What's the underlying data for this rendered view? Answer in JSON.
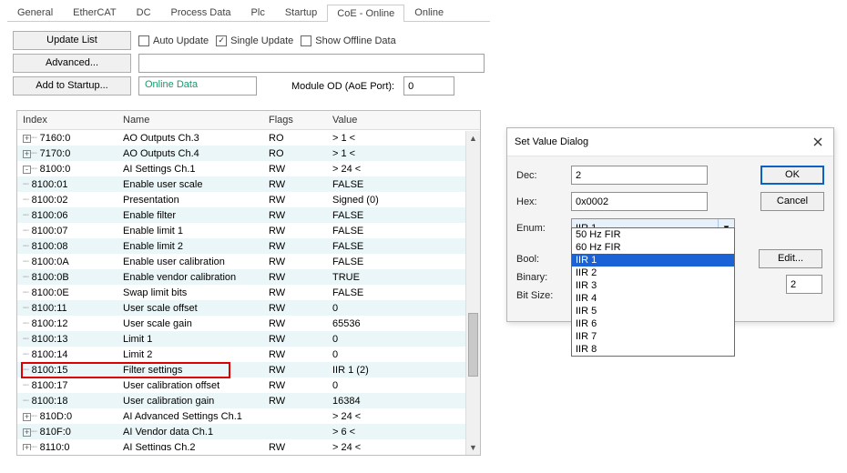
{
  "tabs": [
    "General",
    "EtherCAT",
    "DC",
    "Process Data",
    "Plc",
    "Startup",
    "CoE - Online",
    "Online"
  ],
  "activeTab": "CoE - Online",
  "buttons": {
    "update": "Update List",
    "advanced": "Advanced...",
    "addstartup": "Add to Startup..."
  },
  "checks": {
    "auto": "Auto Update",
    "single": "Single Update",
    "offline": "Show Offline Data"
  },
  "onlineBadge": "Online Data",
  "moduleOd": {
    "label": "Module OD (AoE Port):",
    "value": "0"
  },
  "columns": {
    "index": "Index",
    "name": "Name",
    "flags": "Flags",
    "value": "Value"
  },
  "rows": [
    {
      "pm": "+",
      "idx": "7160:0",
      "name": "AO Outputs Ch.3",
      "flags": "RO",
      "val": "> 1 <",
      "alt": false
    },
    {
      "pm": "+",
      "idx": "7170:0",
      "name": "AO Outputs Ch.4",
      "flags": "RO",
      "val": "> 1 <",
      "alt": true
    },
    {
      "pm": "-",
      "idx": "8100:0",
      "name": "AI Settings Ch.1",
      "flags": "RW",
      "val": "> 24 <",
      "alt": false
    },
    {
      "pm": "",
      "idx": "8100:01",
      "name": "Enable user scale",
      "flags": "RW",
      "val": "FALSE",
      "alt": true,
      "child": true
    },
    {
      "pm": "",
      "idx": "8100:02",
      "name": "Presentation",
      "flags": "RW",
      "val": "Signed (0)",
      "alt": false,
      "child": true
    },
    {
      "pm": "",
      "idx": "8100:06",
      "name": "Enable filter",
      "flags": "RW",
      "val": "FALSE",
      "alt": true,
      "child": true
    },
    {
      "pm": "",
      "idx": "8100:07",
      "name": "Enable limit 1",
      "flags": "RW",
      "val": "FALSE",
      "alt": false,
      "child": true
    },
    {
      "pm": "",
      "idx": "8100:08",
      "name": "Enable limit 2",
      "flags": "RW",
      "val": "FALSE",
      "alt": true,
      "child": true
    },
    {
      "pm": "",
      "idx": "8100:0A",
      "name": "Enable user calibration",
      "flags": "RW",
      "val": "FALSE",
      "alt": false,
      "child": true
    },
    {
      "pm": "",
      "idx": "8100:0B",
      "name": "Enable vendor calibration",
      "flags": "RW",
      "val": "TRUE",
      "alt": true,
      "child": true
    },
    {
      "pm": "",
      "idx": "8100:0E",
      "name": "Swap limit bits",
      "flags": "RW",
      "val": "FALSE",
      "alt": false,
      "child": true
    },
    {
      "pm": "",
      "idx": "8100:11",
      "name": "User scale offset",
      "flags": "RW",
      "val": "0",
      "alt": true,
      "child": true
    },
    {
      "pm": "",
      "idx": "8100:12",
      "name": "User scale gain",
      "flags": "RW",
      "val": "65536",
      "alt": false,
      "child": true
    },
    {
      "pm": "",
      "idx": "8100:13",
      "name": "Limit 1",
      "flags": "RW",
      "val": "0",
      "alt": true,
      "child": true
    },
    {
      "pm": "",
      "idx": "8100:14",
      "name": "Limit 2",
      "flags": "RW",
      "val": "0",
      "alt": false,
      "child": true
    },
    {
      "pm": "",
      "idx": "8100:15",
      "name": "Filter settings",
      "flags": "RW",
      "val": "IIR 1 (2)",
      "alt": true,
      "child": true,
      "boxed": true
    },
    {
      "pm": "",
      "idx": "8100:17",
      "name": "User calibration offset",
      "flags": "RW",
      "val": "0",
      "alt": false,
      "child": true
    },
    {
      "pm": "",
      "idx": "8100:18",
      "name": "User calibration gain",
      "flags": "RW",
      "val": "16384",
      "alt": true,
      "child": true
    },
    {
      "pm": "+",
      "idx": "810D:0",
      "name": "AI Advanced Settings Ch.1",
      "flags": "",
      "val": "> 24 <",
      "alt": false
    },
    {
      "pm": "+",
      "idx": "810F:0",
      "name": "AI Vendor data Ch.1",
      "flags": "",
      "val": "> 6 <",
      "alt": true
    },
    {
      "pm": "+",
      "idx": "8110:0",
      "name": "AI Settings Ch.2",
      "flags": "RW",
      "val": "> 24 <",
      "alt": false
    }
  ],
  "dialog": {
    "title": "Set Value Dialog",
    "dec": {
      "label": "Dec:",
      "value": "2"
    },
    "hex": {
      "label": "Hex:",
      "value": "0x0002"
    },
    "enum": {
      "label": "Enum:",
      "value": "IIR 1"
    },
    "bool": {
      "label": "Bool:"
    },
    "binary": {
      "label": "Binary:"
    },
    "bitsize": {
      "label": "Bit Size:"
    },
    "spin": "2",
    "ok": "OK",
    "cancel": "Cancel",
    "edit": "Edit...",
    "options": [
      "50 Hz FIR",
      "60 Hz FIR",
      "IIR 1",
      "IIR 2",
      "IIR 3",
      "IIR 4",
      "IIR 5",
      "IIR 6",
      "IIR 7",
      "IIR 8"
    ],
    "selected": "IIR 1"
  }
}
